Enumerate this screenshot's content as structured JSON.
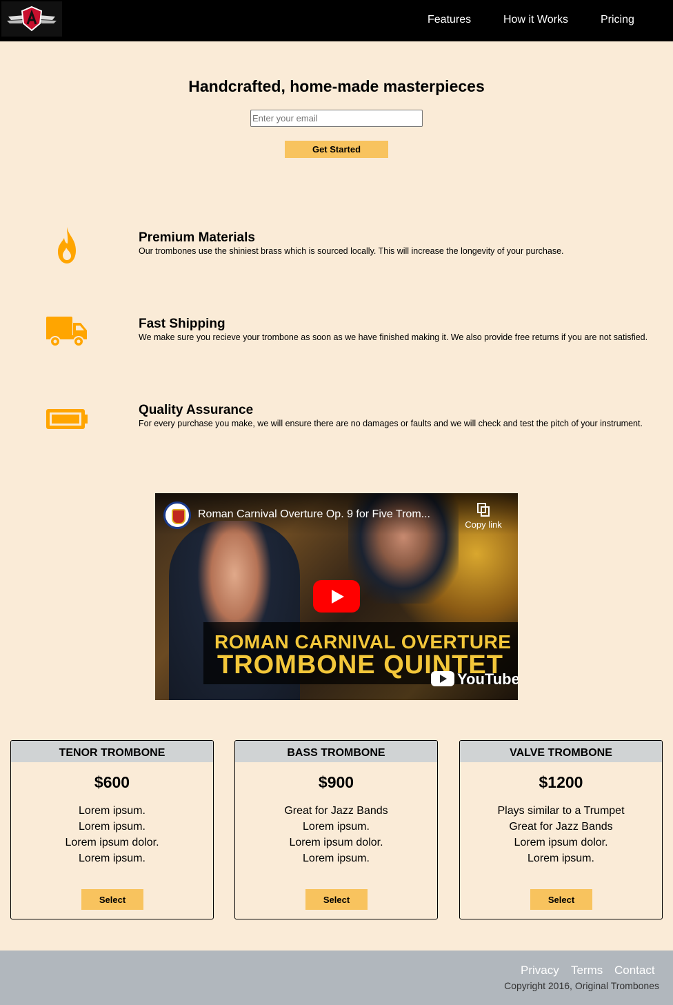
{
  "header": {
    "logo_alt": "Original Trombones logo",
    "nav": [
      "Features",
      "How it Works",
      "Pricing"
    ]
  },
  "hero": {
    "title": "Handcrafted, home-made masterpieces",
    "email_placeholder": "Enter your email",
    "cta": "Get Started"
  },
  "features": [
    {
      "icon": "fire-icon",
      "title": "Premium Materials",
      "text": "Our trombones use the shiniest brass which is sourced locally. This will increase the longevity of your purchase."
    },
    {
      "icon": "truck-icon",
      "title": "Fast Shipping",
      "text": "We make sure you recieve your trombone as soon as we have finished making it. We also provide free returns if you are not satisfied."
    },
    {
      "icon": "battery-icon",
      "title": "Quality Assurance",
      "text": "For every purchase you make, we will ensure there are no damages or faults and we will check and test the pitch of your instrument."
    }
  ],
  "video": {
    "title": "Roman Carnival Overture Op. 9 for Five Trom...",
    "copy_link": "Copy link",
    "caption_line1": "ROMAN CARNIVAL OVERTURE",
    "caption_line2": "TROMBONE QUINTET",
    "brand": "YouTube"
  },
  "pricing": [
    {
      "name": "TENOR TROMBONE",
      "price": "$600",
      "features": [
        "Lorem ipsum.",
        "Lorem ipsum.",
        "Lorem ipsum dolor.",
        "Lorem ipsum."
      ],
      "button": "Select"
    },
    {
      "name": "BASS TROMBONE",
      "price": "$900",
      "features": [
        "Great for Jazz Bands",
        "Lorem ipsum.",
        "Lorem ipsum dolor.",
        "Lorem ipsum."
      ],
      "button": "Select"
    },
    {
      "name": "VALVE TROMBONE",
      "price": "$1200",
      "features": [
        "Plays similar to a Trumpet",
        "Great for Jazz Bands",
        "Lorem ipsum dolor.",
        "Lorem ipsum."
      ],
      "button": "Select"
    }
  ],
  "footer": {
    "links": [
      "Privacy",
      "Terms",
      "Contact"
    ],
    "copyright": "Copyright 2016, Original Trombones"
  },
  "colors": {
    "page_bg": "#faebd7",
    "accent": "#f8c35e",
    "icon": "#ffa500",
    "header_bg": "#000000",
    "footer_bg": "#b1b7bd"
  }
}
